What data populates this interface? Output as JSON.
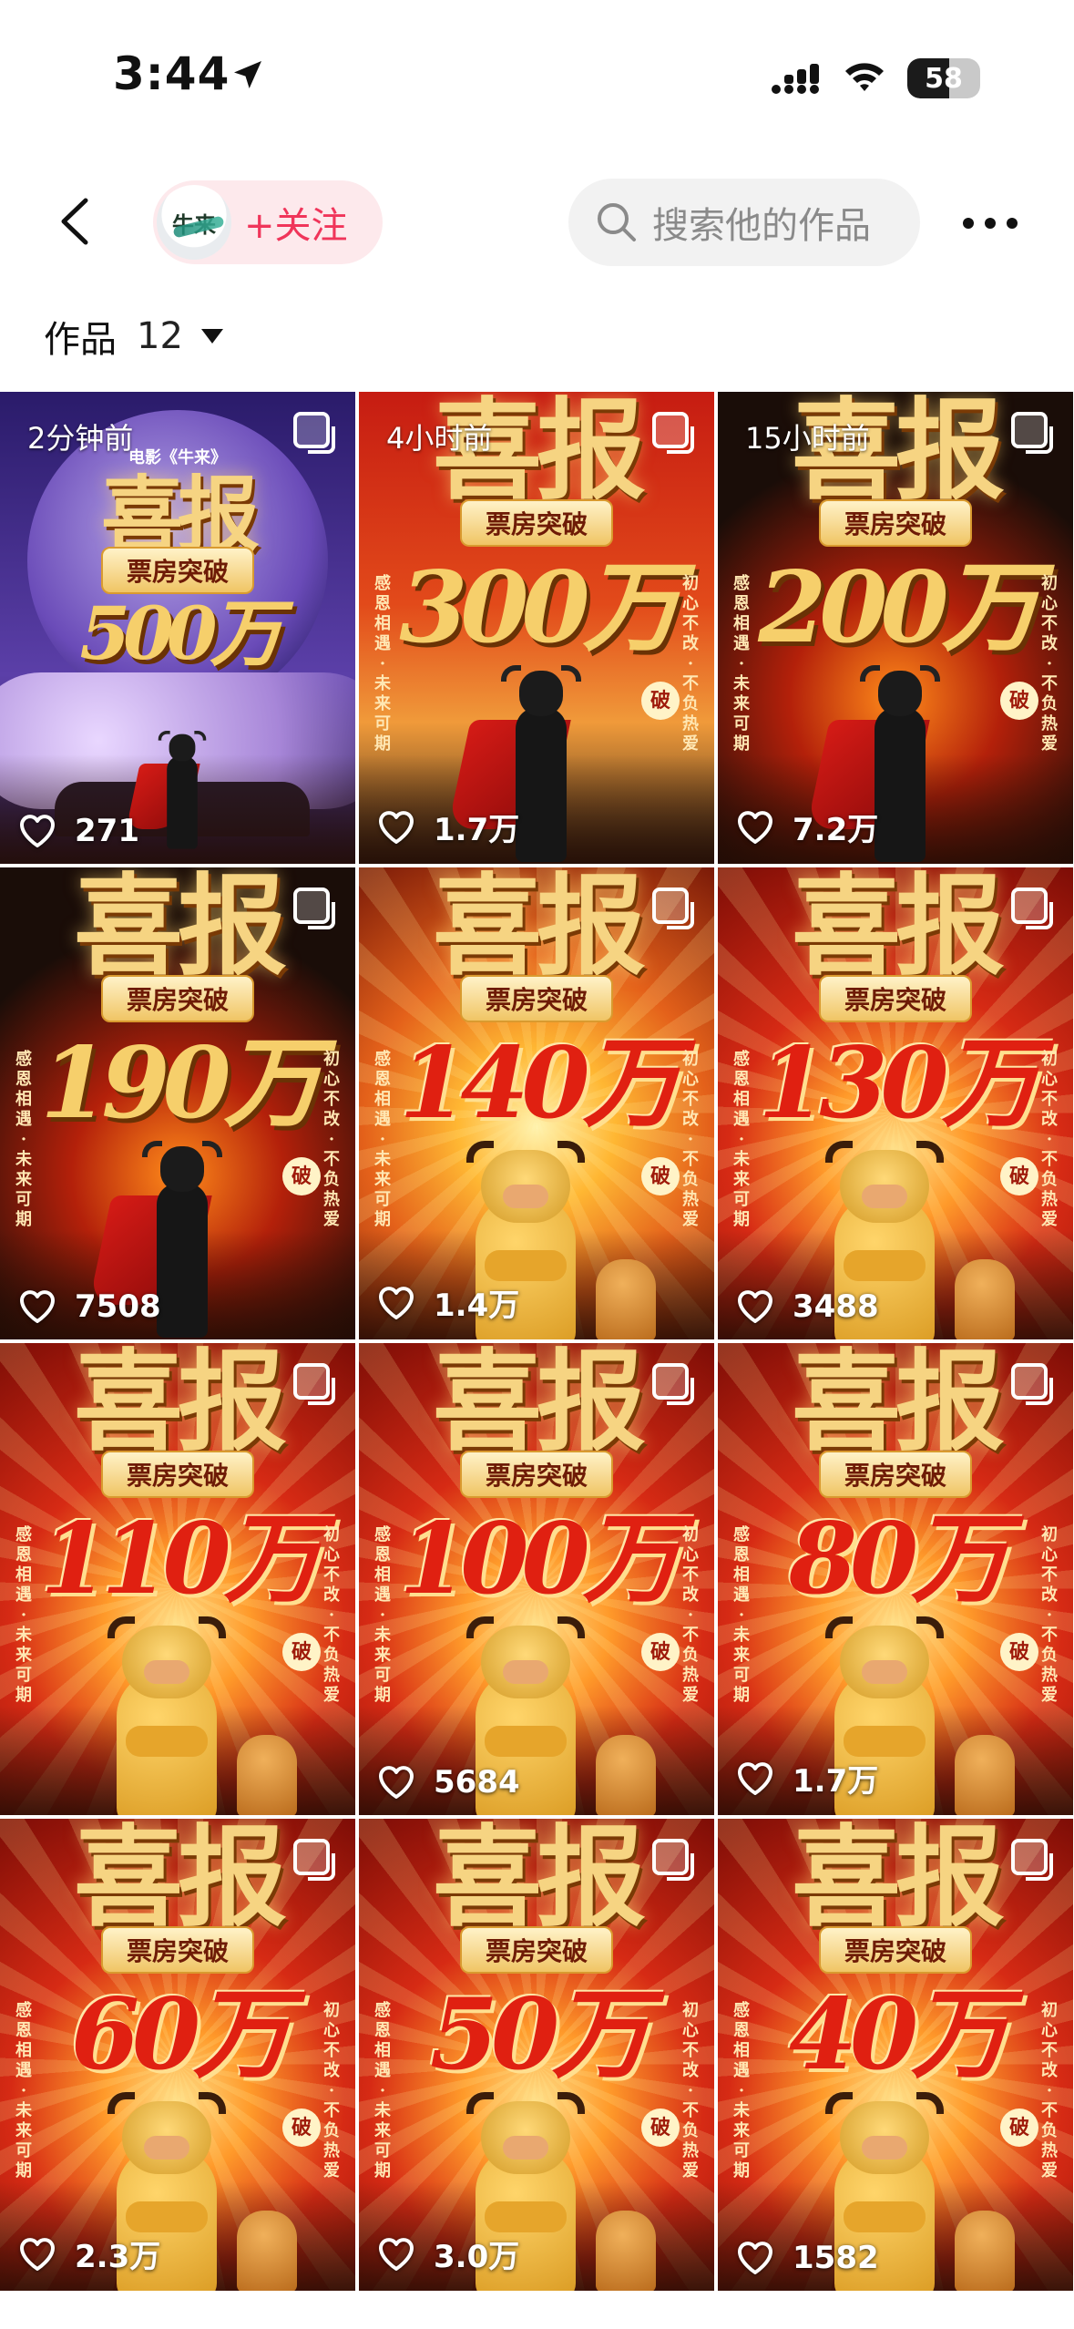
{
  "status_bar": {
    "time": "3:44",
    "battery": "58",
    "battery_fraction": 0.58
  },
  "header": {
    "follow_label": "+关注",
    "avatar_text": "牛来",
    "search_placeholder": "搜索他的作品"
  },
  "filter": {
    "label": "作品",
    "count": "12"
  },
  "posts": [
    {
      "time": "2分钟前",
      "likes": "271",
      "headline": "喜报",
      "subtitle": "票房突破",
      "amount": "500万",
      "top_note": "电影《牛来》",
      "style": "purple"
    },
    {
      "time": "4小时前",
      "likes": "1.7万",
      "headline": "喜报",
      "subtitle": "票房突破",
      "amount": "300万",
      "style": "red-bull"
    },
    {
      "time": "15小时前",
      "likes": "7.2万",
      "headline": "喜报",
      "subtitle": "票房突破",
      "amount": "200万",
      "style": "dark-bull"
    },
    {
      "time": "",
      "likes": "7508",
      "headline": "喜报",
      "subtitle": "票房突破",
      "amount": "190万",
      "style": "dark-bull"
    },
    {
      "time": "",
      "likes": "1.4万",
      "headline": "喜报",
      "subtitle": "票房突破",
      "amount": "140万",
      "style": "gold-mascot"
    },
    {
      "time": "",
      "likes": "3488",
      "headline": "喜报",
      "subtitle": "票房突破",
      "amount": "130万",
      "style": "red-mascot"
    },
    {
      "time": "",
      "likes": "",
      "headline": "喜报",
      "subtitle": "票房突破",
      "amount": "110万",
      "style": "red-mascot"
    },
    {
      "time": "",
      "likes": "5684",
      "headline": "喜报",
      "subtitle": "票房突破",
      "amount": "100万",
      "style": "red-mascot"
    },
    {
      "time": "",
      "likes": "1.7万",
      "headline": "喜报",
      "subtitle": "票房突破",
      "amount": "80万",
      "style": "red-mascot"
    },
    {
      "time": "",
      "likes": "2.3万",
      "headline": "喜报",
      "subtitle": "票房突破",
      "amount": "60万",
      "style": "red-mascot"
    },
    {
      "time": "",
      "likes": "3.0万",
      "headline": "喜报",
      "subtitle": "票房突破",
      "amount": "50万",
      "style": "red-mascot"
    },
    {
      "time": "",
      "likes": "1582",
      "headline": "喜报",
      "subtitle": "票房突破",
      "amount": "40万",
      "style": "red-mascot"
    }
  ],
  "poster_side_text": {
    "left": "感恩相遇·未来可期",
    "right": "初心不改·不负热爱",
    "seal": "破"
  },
  "colors": {
    "accent": "#f0355a",
    "follow_bg": "#fde9ec",
    "search_bg": "#f2f2f2"
  }
}
